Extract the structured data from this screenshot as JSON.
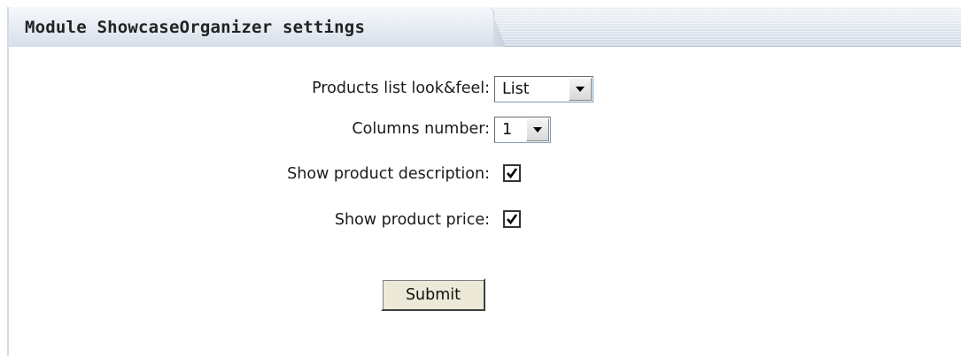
{
  "panel": {
    "title": "Module ShowcaseOrganizer settings"
  },
  "form": {
    "look_feel": {
      "label": "Products list look&feel:",
      "selected": "List"
    },
    "columns": {
      "label": "Columns number:",
      "selected": "1"
    },
    "show_description": {
      "label": "Show product description:",
      "checked": true
    },
    "show_price": {
      "label": "Show product price:",
      "checked": true
    },
    "submit_label": "Submit"
  },
  "icons": {
    "dropdown": "chevron-down-icon",
    "check": "checkmark-icon"
  },
  "colors": {
    "header_bg": "#dfe6ef",
    "panel_border": "#d3dbe6",
    "button_face": "#ece9d8"
  }
}
